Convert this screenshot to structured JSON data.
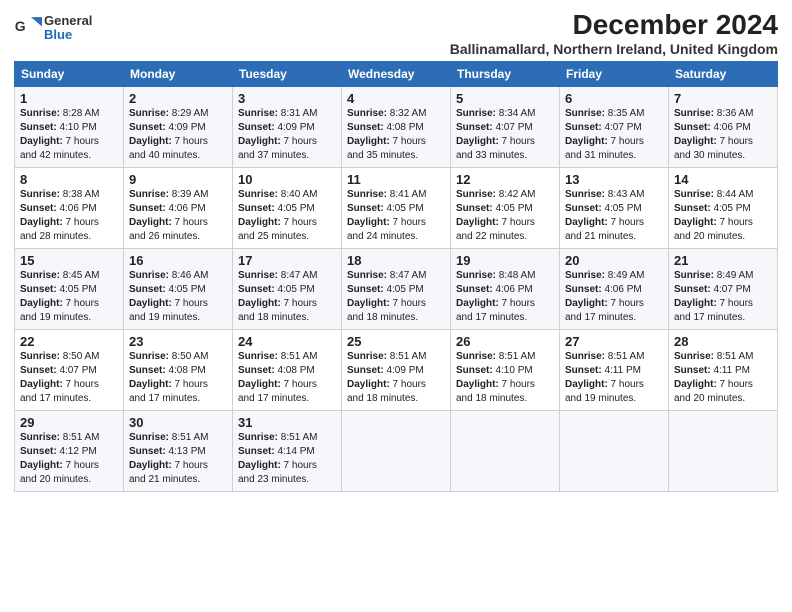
{
  "logo": {
    "general": "General",
    "blue": "Blue"
  },
  "title": "December 2024",
  "subtitle": "Ballinamallard, Northern Ireland, United Kingdom",
  "days_header": [
    "Sunday",
    "Monday",
    "Tuesday",
    "Wednesday",
    "Thursday",
    "Friday",
    "Saturday"
  ],
  "weeks": [
    [
      {
        "day": 1,
        "sunrise": "8:28 AM",
        "sunset": "4:10 PM",
        "daylight": "7 hours and 42 minutes."
      },
      {
        "day": 2,
        "sunrise": "8:29 AM",
        "sunset": "4:09 PM",
        "daylight": "7 hours and 40 minutes."
      },
      {
        "day": 3,
        "sunrise": "8:31 AM",
        "sunset": "4:09 PM",
        "daylight": "7 hours and 37 minutes."
      },
      {
        "day": 4,
        "sunrise": "8:32 AM",
        "sunset": "4:08 PM",
        "daylight": "7 hours and 35 minutes."
      },
      {
        "day": 5,
        "sunrise": "8:34 AM",
        "sunset": "4:07 PM",
        "daylight": "7 hours and 33 minutes."
      },
      {
        "day": 6,
        "sunrise": "8:35 AM",
        "sunset": "4:07 PM",
        "daylight": "7 hours and 31 minutes."
      },
      {
        "day": 7,
        "sunrise": "8:36 AM",
        "sunset": "4:06 PM",
        "daylight": "7 hours and 30 minutes."
      }
    ],
    [
      {
        "day": 8,
        "sunrise": "8:38 AM",
        "sunset": "4:06 PM",
        "daylight": "7 hours and 28 minutes."
      },
      {
        "day": 9,
        "sunrise": "8:39 AM",
        "sunset": "4:06 PM",
        "daylight": "7 hours and 26 minutes."
      },
      {
        "day": 10,
        "sunrise": "8:40 AM",
        "sunset": "4:05 PM",
        "daylight": "7 hours and 25 minutes."
      },
      {
        "day": 11,
        "sunrise": "8:41 AM",
        "sunset": "4:05 PM",
        "daylight": "7 hours and 24 minutes."
      },
      {
        "day": 12,
        "sunrise": "8:42 AM",
        "sunset": "4:05 PM",
        "daylight": "7 hours and 22 minutes."
      },
      {
        "day": 13,
        "sunrise": "8:43 AM",
        "sunset": "4:05 PM",
        "daylight": "7 hours and 21 minutes."
      },
      {
        "day": 14,
        "sunrise": "8:44 AM",
        "sunset": "4:05 PM",
        "daylight": "7 hours and 20 minutes."
      }
    ],
    [
      {
        "day": 15,
        "sunrise": "8:45 AM",
        "sunset": "4:05 PM",
        "daylight": "7 hours and 19 minutes."
      },
      {
        "day": 16,
        "sunrise": "8:46 AM",
        "sunset": "4:05 PM",
        "daylight": "7 hours and 19 minutes."
      },
      {
        "day": 17,
        "sunrise": "8:47 AM",
        "sunset": "4:05 PM",
        "daylight": "7 hours and 18 minutes."
      },
      {
        "day": 18,
        "sunrise": "8:47 AM",
        "sunset": "4:05 PM",
        "daylight": "7 hours and 18 minutes."
      },
      {
        "day": 19,
        "sunrise": "8:48 AM",
        "sunset": "4:06 PM",
        "daylight": "7 hours and 17 minutes."
      },
      {
        "day": 20,
        "sunrise": "8:49 AM",
        "sunset": "4:06 PM",
        "daylight": "7 hours and 17 minutes."
      },
      {
        "day": 21,
        "sunrise": "8:49 AM",
        "sunset": "4:07 PM",
        "daylight": "7 hours and 17 minutes."
      }
    ],
    [
      {
        "day": 22,
        "sunrise": "8:50 AM",
        "sunset": "4:07 PM",
        "daylight": "7 hours and 17 minutes."
      },
      {
        "day": 23,
        "sunrise": "8:50 AM",
        "sunset": "4:08 PM",
        "daylight": "7 hours and 17 minutes."
      },
      {
        "day": 24,
        "sunrise": "8:51 AM",
        "sunset": "4:08 PM",
        "daylight": "7 hours and 17 minutes."
      },
      {
        "day": 25,
        "sunrise": "8:51 AM",
        "sunset": "4:09 PM",
        "daylight": "7 hours and 18 minutes."
      },
      {
        "day": 26,
        "sunrise": "8:51 AM",
        "sunset": "4:10 PM",
        "daylight": "7 hours and 18 minutes."
      },
      {
        "day": 27,
        "sunrise": "8:51 AM",
        "sunset": "4:11 PM",
        "daylight": "7 hours and 19 minutes."
      },
      {
        "day": 28,
        "sunrise": "8:51 AM",
        "sunset": "4:11 PM",
        "daylight": "7 hours and 20 minutes."
      }
    ],
    [
      {
        "day": 29,
        "sunrise": "8:51 AM",
        "sunset": "4:12 PM",
        "daylight": "7 hours and 20 minutes."
      },
      {
        "day": 30,
        "sunrise": "8:51 AM",
        "sunset": "4:13 PM",
        "daylight": "7 hours and 21 minutes."
      },
      {
        "day": 31,
        "sunrise": "8:51 AM",
        "sunset": "4:14 PM",
        "daylight": "7 hours and 23 minutes."
      },
      null,
      null,
      null,
      null
    ]
  ],
  "labels": {
    "sunrise": "Sunrise: ",
    "sunset": "Sunset: ",
    "daylight": "Daylight: "
  }
}
